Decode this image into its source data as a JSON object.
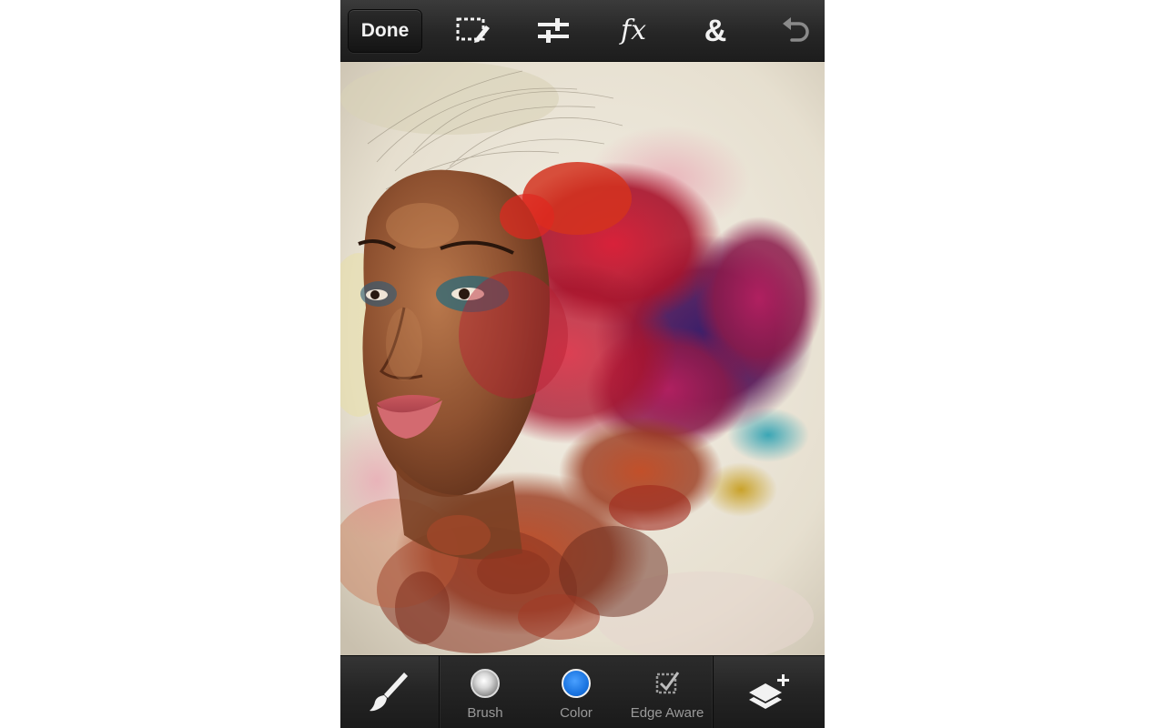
{
  "top_toolbar": {
    "done_label": "Done",
    "tools": [
      "selection-tool-icon",
      "adjustments-sliders-icon",
      "effects-fx-icon",
      "compose-ampersand-icon",
      "undo-icon"
    ],
    "fx_glyph": "fx",
    "amp_glyph": "&"
  },
  "canvas": {
    "description_icon": "photo-canvas"
  },
  "bottom_toolbar": {
    "brush_tool_icon": "paintbrush-icon",
    "options": {
      "brush_label": "Brush",
      "color_label": "Color",
      "edge_aware_label": "Edge Aware"
    },
    "selected_color": "#1a74e0",
    "layers_icon": "add-layer-icon"
  },
  "colors": {
    "toolbar_bg": "#262626",
    "icon_color": "#f2f2f2",
    "label_color": "#9a9a9a",
    "page_bg": "#ffffff"
  }
}
